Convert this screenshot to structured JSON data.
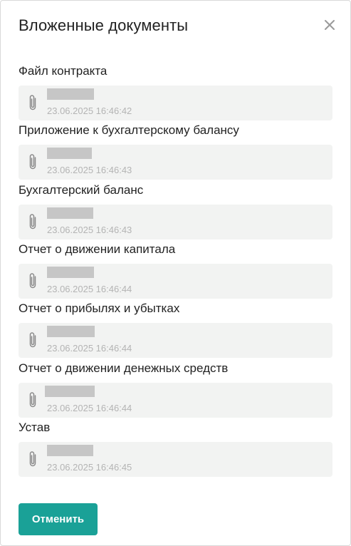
{
  "dialog": {
    "title": "Вложенные документы",
    "close_icon": "close-icon"
  },
  "documents": [
    {
      "label": "Файл контракта",
      "file_name": "",
      "date": "23.06.2025 16:46:42"
    },
    {
      "label": "Приложение к бухгалтерскому балансу",
      "file_name": "",
      "date": "23.06.2025 16:46:43"
    },
    {
      "label": "Бухгалтерский баланс",
      "file_name": "",
      "date": "23.06.2025 16:46:43"
    },
    {
      "label": "Отчет о движении капитала",
      "file_name": "",
      "date": "23.06.2025 16:46:44"
    },
    {
      "label": "Отчет о прибылях и убытках",
      "file_name": "",
      "date": "23.06.2025 16:46:44"
    },
    {
      "label": "Отчет о движении денежных средств",
      "file_name": "",
      "date": "23.06.2025 16:46:44"
    },
    {
      "label": "Устав",
      "file_name": "",
      "date": "23.06.2025 16:46:45"
    }
  ],
  "attachment_icon": "paperclip-icon",
  "footer": {
    "cancel_label": "Отменить"
  },
  "colors": {
    "accent": "#1aa197",
    "card_background": "#f2f3f2",
    "redacted": "#c6c6c6"
  }
}
